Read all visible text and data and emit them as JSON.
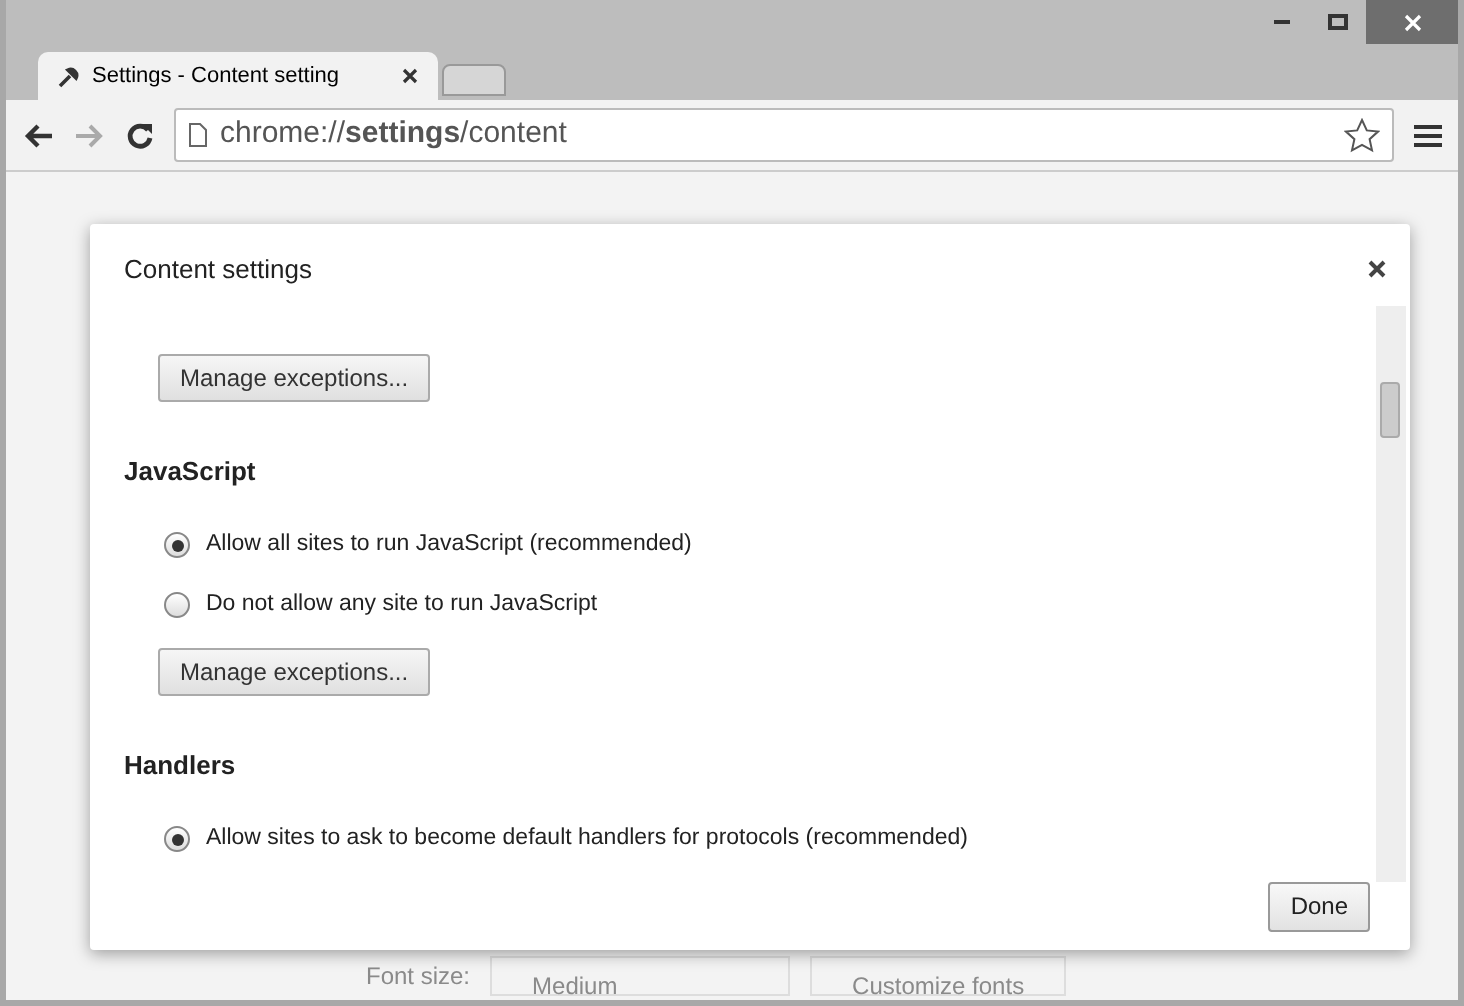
{
  "tab": {
    "title": "Settings - Content setting"
  },
  "address": {
    "url": "chrome://**settings**/content"
  },
  "dialog": {
    "title": "Content settings",
    "items": [
      {
        "kind": "button",
        "label": "Manage exceptions..."
      },
      {
        "kind": "heading",
        "label": "JavaScript"
      },
      {
        "kind": "radio",
        "label": "Allow all sites to run JavaScript (recommended)",
        "selected": true
      },
      {
        "kind": "radio",
        "label": "Do not allow any site to run JavaScript",
        "selected": false
      },
      {
        "kind": "button",
        "label": "Manage exceptions..."
      },
      {
        "kind": "heading",
        "label": "Handlers"
      },
      {
        "kind": "radio",
        "label": "Allow sites to ask to become default handlers for protocols (recommended)",
        "selected": true
      }
    ],
    "done": "Done"
  },
  "background_row": {
    "label": "Font size:",
    "select": "Medium",
    "button": "Customize fonts"
  }
}
